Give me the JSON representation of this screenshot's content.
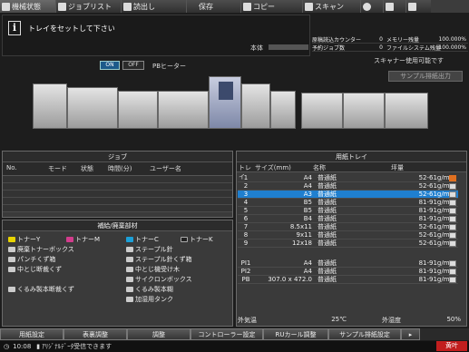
{
  "tabs": [
    {
      "label": "機械状態",
      "active": true
    },
    {
      "label": "ジョブリスト",
      "active": false
    },
    {
      "label": "読出し",
      "active": false
    },
    {
      "label": "保存",
      "active": false
    },
    {
      "label": "コピー",
      "active": false
    },
    {
      "label": "スキャン",
      "active": false
    }
  ],
  "message": "トレイをセットして下さい",
  "body_label": "本体",
  "counters": {
    "row1_left": "原稿読込カウンター",
    "row1_left_val": "0",
    "row1_right": "メモリー残量",
    "row1_right_val": "100.000%",
    "row2_left": "予約ジョブ数",
    "row2_left_val": "0",
    "row2_right": "ファイルシステム残量",
    "row2_right_val": "100.000%"
  },
  "heater": {
    "on": "ON",
    "off": "OFF",
    "label": "PBヒーター"
  },
  "scanner_msg": "スキャナー使用可能です",
  "sample_output": "サンプル排紙出力",
  "jobs": {
    "title": "ジョブ",
    "headers": [
      "No.",
      "モード",
      "状態",
      "時間(分)",
      "ユーザー名"
    ]
  },
  "supplies": {
    "title": "補給/廃棄部材",
    "items": [
      "トナーY",
      "トナーM",
      "トナーC",
      "トナーK",
      "廃棄トナーボックス",
      "ステープル針",
      "パンチくず箱",
      "ステープル針くず箱",
      "中とじ断裁くず",
      "中とじ機受け木",
      "サイクロンボックス",
      "くるみ製本断裁くず",
      "くるみ製本糊",
      "加湿用タンク"
    ]
  },
  "trays": {
    "title": "用紙トレイ",
    "headers": [
      "トレイ",
      "サイズ(mm)",
      "名称",
      "坪量"
    ],
    "rows": [
      {
        "tray": "1",
        "size": "A4",
        "name": "普通紙",
        "weight": "52-61g/m2"
      },
      {
        "tray": "2",
        "size": "A4",
        "name": "普通紙",
        "weight": "52-61g/m2"
      },
      {
        "tray": "3",
        "size": "A3",
        "name": "普通紙",
        "weight": "52-61g/m2"
      },
      {
        "tray": "4",
        "size": "B5",
        "name": "普通紙",
        "weight": "81-91g/m2"
      },
      {
        "tray": "5",
        "size": "B5",
        "name": "普通紙",
        "weight": "81-91g/m2"
      },
      {
        "tray": "6",
        "size": "B4",
        "name": "普通紙",
        "weight": "81-91g/m2"
      },
      {
        "tray": "7",
        "size": "8.5x11",
        "name": "普通紙",
        "weight": "52-61g/m2"
      },
      {
        "tray": "8",
        "size": "9x11",
        "name": "普通紙",
        "weight": "52-61g/m2"
      },
      {
        "tray": "9",
        "size": "12x18",
        "name": "普通紙",
        "weight": "52-61g/m2"
      },
      {
        "tray": "PI1",
        "size": "A4",
        "name": "普通紙",
        "weight": "81-91g/m2"
      },
      {
        "tray": "PI2",
        "size": "A4",
        "name": "普通紙",
        "weight": "81-91g/m2"
      },
      {
        "tray": "PB",
        "size": "307.0 x 472.0",
        "name": "普通紙",
        "weight": "81-91g/m2"
      }
    ],
    "temp_label": "外気温",
    "temp_val": "25℃",
    "hum_label": "外湿度",
    "hum_val": "50%"
  },
  "bottom_buttons": [
    "用紙設定",
    "表裏調整",
    "調整",
    "コントローラー設定",
    "RUカール調整",
    "サンプル排紙設定",
    "▸"
  ],
  "status": {
    "time": "10:08",
    "message": "ｱﾘｼﾞﾅﾙﾃﾞｰﾀ受信できます",
    "ink": "黄叶"
  },
  "colors": {
    "accent": "#1f7fcf",
    "alert": "#c21e1e"
  }
}
